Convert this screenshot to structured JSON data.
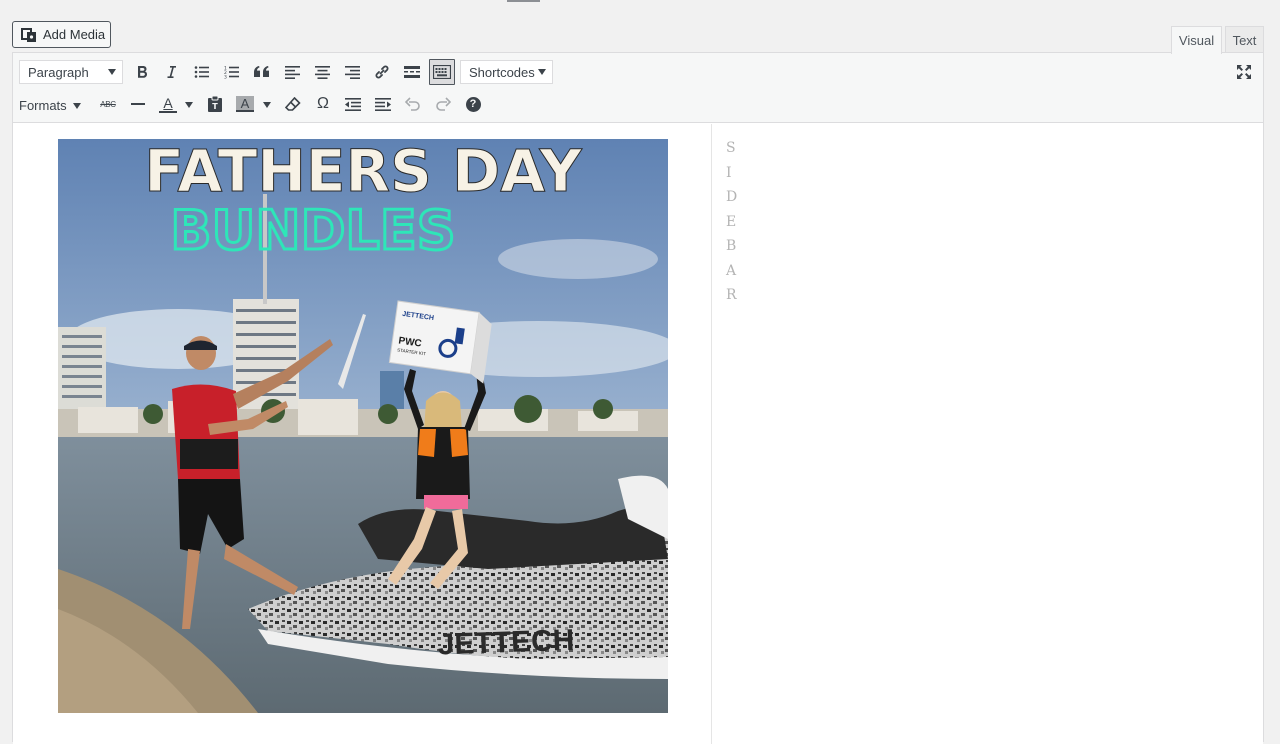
{
  "add_media": {
    "label": "Add Media",
    "icon": "add-media-icon"
  },
  "tabs": {
    "visual": "Visual",
    "text": "Text"
  },
  "toolbar": {
    "paragraph_select": "Paragraph",
    "shortcodes_select": "Shortcodes",
    "formats_label": "Formats",
    "strikethrough_label": "ABC",
    "text_color_label": "A",
    "bg_color_label": "A",
    "omega_label": "Ω",
    "help_label": "?"
  },
  "image": {
    "headline": "FATHERS DAY",
    "subheadline": "BUNDLES",
    "box_brand": "JETTECH",
    "box_text": "PWC",
    "box_subtext": "STARTER KIT",
    "hull_text": "JETTECH"
  },
  "sidebar": {
    "letters": [
      "S",
      "I",
      "D",
      "E",
      "B",
      "A",
      "R"
    ]
  },
  "colors": {
    "accent": "#2271b1",
    "headline": "#f7f2e6",
    "subheadline": "#2ee6b8"
  }
}
